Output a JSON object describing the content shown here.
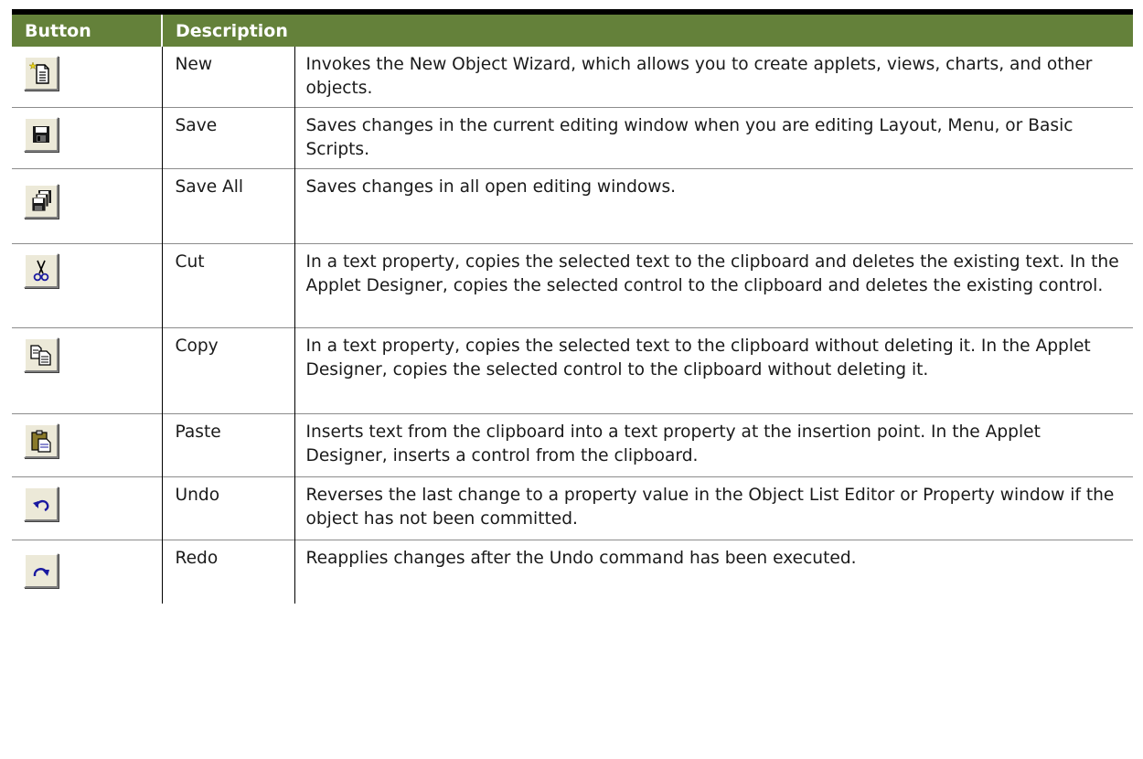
{
  "table": {
    "headers": {
      "button": "Button",
      "description": "Description"
    },
    "rows": [
      {
        "icon": "new-icon",
        "name": "New",
        "description": "Invokes the New Object Wizard, which allows you to create applets, views, charts, and other objects."
      },
      {
        "icon": "save-icon",
        "name": "Save",
        "description": "Saves changes in the current editing window when you are editing Layout, Menu, or Basic Scripts."
      },
      {
        "icon": "save-all-icon",
        "name": "Save All",
        "description": "Saves changes in all open editing windows."
      },
      {
        "icon": "cut-icon",
        "name": "Cut",
        "description": "In a text property, copies the selected text to the clipboard and deletes the existing text. In the Applet Designer, copies the selected control to the clipboard and deletes the existing control."
      },
      {
        "icon": "copy-icon",
        "name": "Copy",
        "description": "In a text property, copies the selected text to the clipboard without deleting it. In the Applet Designer, copies the selected control to the clipboard without deleting it."
      },
      {
        "icon": "paste-icon",
        "name": "Paste",
        "description": "Inserts text from the clipboard into a text property at the insertion point. In the Applet Designer, inserts a control from the clipboard."
      },
      {
        "icon": "undo-icon",
        "name": "Undo",
        "description": "Reverses the last change to a property value in the Object List Editor or Property window if the object has not been committed."
      },
      {
        "icon": "redo-icon",
        "name": "Redo",
        "description": "Reapplies changes after the Undo command has been executed."
      }
    ]
  },
  "colors": {
    "header_bg": "#64813a",
    "header_text": "#ffffff",
    "button_face": "#ece9d8"
  }
}
